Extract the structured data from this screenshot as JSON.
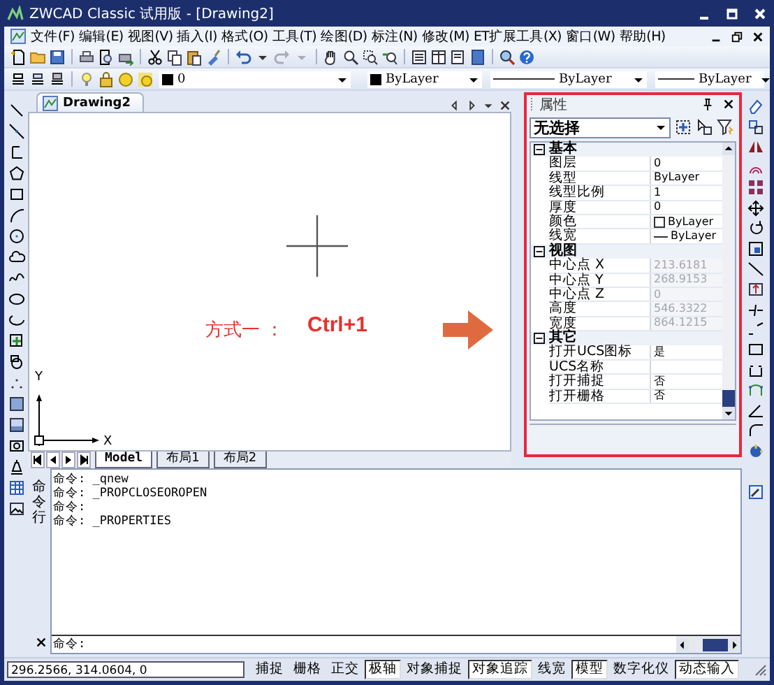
{
  "window": {
    "title": "ZWCAD Classic 试用版 - [Drawing2]"
  },
  "menu": [
    "文件(F)",
    "编辑(E)",
    "视图(V)",
    "插入(I)",
    "格式(O)",
    "工具(T)",
    "绘图(D)",
    "标注(N)",
    "修改(M)",
    "ET扩展工具(X)",
    "窗口(W)",
    "帮助(H)"
  ],
  "layer_toolbar": {
    "layer": "0",
    "object_color": "ByLayer",
    "linetype": "ByLayer",
    "lineweight": "ByLayer"
  },
  "document_tab": {
    "title": "Drawing2"
  },
  "annotation": {
    "text": "方式一 ：",
    "shortcut": "Ctrl+1"
  },
  "axes": {
    "x": "X",
    "y": "Y"
  },
  "layout_tabs": [
    {
      "label": "Model",
      "selected": true
    },
    {
      "label": "布局1",
      "selected": false
    },
    {
      "label": "布局2",
      "selected": false
    }
  ],
  "properties": {
    "title": "属性",
    "selection": "无选择",
    "groups": [
      {
        "name": "基本",
        "expanded": true,
        "rows": [
          {
            "name": "图层",
            "value": "0",
            "kind": "text",
            "disabled": false
          },
          {
            "name": "线型",
            "value": "ByLayer",
            "kind": "text",
            "disabled": false
          },
          {
            "name": "线型比例",
            "value": "1",
            "kind": "text",
            "disabled": false
          },
          {
            "name": "厚度",
            "value": "0",
            "kind": "text",
            "disabled": false
          },
          {
            "name": "颜色",
            "value": "ByLayer",
            "kind": "color",
            "disabled": false
          },
          {
            "name": "线宽",
            "value": "ByLayer",
            "kind": "lineweight",
            "disabled": false
          }
        ]
      },
      {
        "name": "视图",
        "expanded": true,
        "rows": [
          {
            "name": "中心点 X",
            "value": "213.6181",
            "kind": "text",
            "disabled": true
          },
          {
            "name": "中心点 Y",
            "value": "268.9153",
            "kind": "text",
            "disabled": true
          },
          {
            "name": "中心点 Z",
            "value": "0",
            "kind": "text",
            "disabled": true
          },
          {
            "name": "高度",
            "value": "546.3322",
            "kind": "text",
            "disabled": true
          },
          {
            "name": "宽度",
            "value": "864.1215",
            "kind": "text",
            "disabled": true
          }
        ]
      },
      {
        "name": "其它",
        "expanded": true,
        "rows": [
          {
            "name": "打开UCS图标",
            "value": "是",
            "kind": "text",
            "disabled": false
          },
          {
            "name": "UCS名称",
            "kind": "text",
            "disabled": false
          },
          {
            "name": "打开捕捉",
            "value": "否",
            "kind": "text",
            "disabled": false
          },
          {
            "name": "打开栅格",
            "value": "否",
            "kind": "text",
            "disabled": false
          }
        ]
      }
    ]
  },
  "command_line": {
    "label": "命令行",
    "history": [
      "命令: _qnew",
      "命令: _PROPCLOSEOROPEN",
      "命令:",
      "命令: _PROPERTIES"
    ],
    "prompt": "命令:"
  },
  "status_bar": {
    "coordinates": "296.2566, 314.0604, 0",
    "toggles": [
      {
        "label": "捕捉",
        "on": false
      },
      {
        "label": "栅格",
        "on": false
      },
      {
        "label": "正交",
        "on": false
      },
      {
        "label": "极轴",
        "on": true
      },
      {
        "label": "对象捕捉",
        "on": false
      },
      {
        "label": "对象追踪",
        "on": true
      },
      {
        "label": "线宽",
        "on": false
      },
      {
        "label": "模型",
        "on": true
      },
      {
        "label": "数字化仪",
        "on": false
      },
      {
        "label": "动态输入",
        "on": true
      }
    ]
  }
}
